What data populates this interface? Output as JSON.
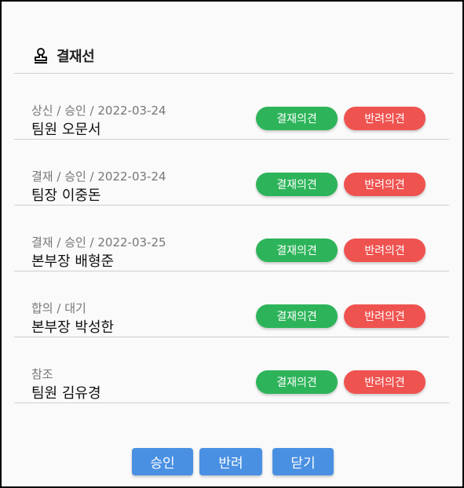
{
  "dialog": {
    "title": "결재선",
    "icon": "stamp-icon"
  },
  "colors": {
    "approve": "#2db45a",
    "reject": "#ef5350",
    "primary": "#4a90e2"
  },
  "approvers": [
    {
      "status": "상신 / 승인 / 2022-03-24",
      "name": "팀원 오문서",
      "opinion_label": "결재의견",
      "reject_label": "반려의견"
    },
    {
      "status": "결재 / 승인 / 2022-03-24",
      "name": "팀장 이중돈",
      "opinion_label": "결재의견",
      "reject_label": "반려의견"
    },
    {
      "status": "결재 / 승인 / 2022-03-25",
      "name": "본부장 배형준",
      "opinion_label": "결재의견",
      "reject_label": "반려의견"
    },
    {
      "status": "합의 / 대기",
      "name": "본부장 박성한",
      "opinion_label": "결재의견",
      "reject_label": "반려의견"
    },
    {
      "status": "참조",
      "name": "팀원 김유경",
      "opinion_label": "결재의견",
      "reject_label": "반려의견"
    }
  ],
  "actions": {
    "approve": "승인",
    "reject": "반려",
    "close": "닫기"
  }
}
